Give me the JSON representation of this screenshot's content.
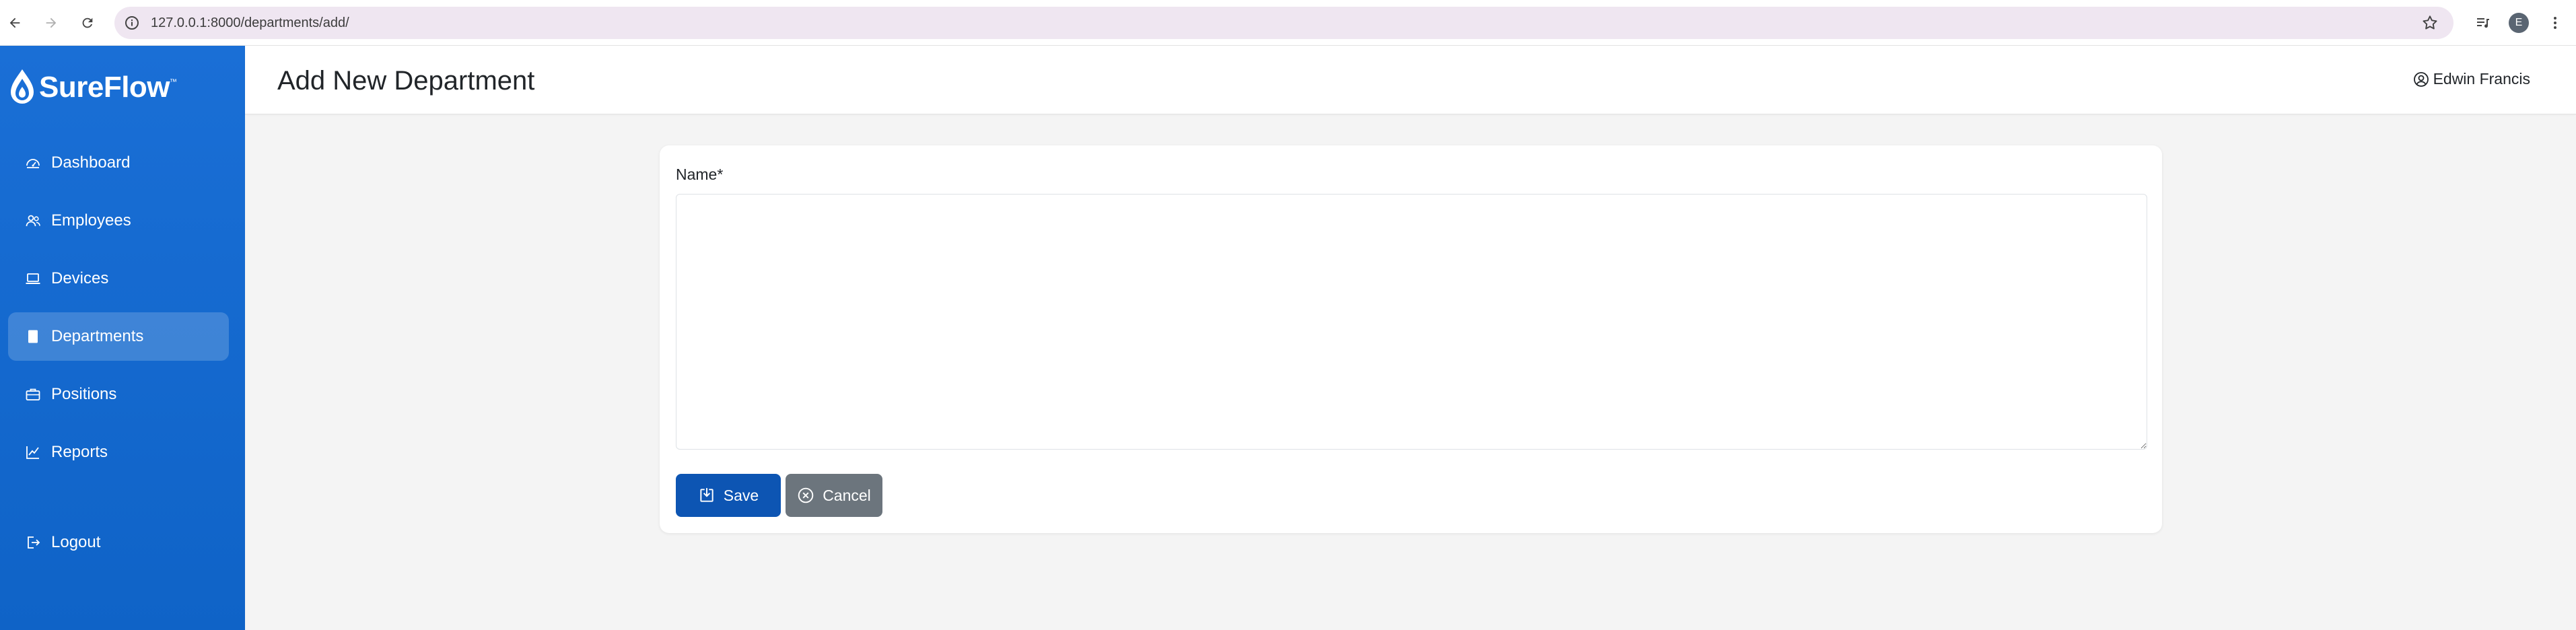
{
  "browser": {
    "url": "127.0.0.1:8000/departments/add/",
    "profile_initial": "E"
  },
  "brand": {
    "name": "SureFlow",
    "trademark": "™",
    "primary_color": "#1a6fd6"
  },
  "sidebar": {
    "items": [
      {
        "label": "Dashboard",
        "icon": "dashboard-icon"
      },
      {
        "label": "Employees",
        "icon": "people-icon"
      },
      {
        "label": "Devices",
        "icon": "laptop-icon"
      },
      {
        "label": "Departments",
        "icon": "building-icon",
        "active": true
      },
      {
        "label": "Positions",
        "icon": "briefcase-icon"
      },
      {
        "label": "Reports",
        "icon": "chart-line-icon"
      }
    ],
    "logout_label": "Logout"
  },
  "header": {
    "title": "Add New Department",
    "user_name": "Edwin Francis"
  },
  "form": {
    "name_label": "Name*",
    "name_value": "",
    "save_label": "Save",
    "cancel_label": "Cancel"
  }
}
